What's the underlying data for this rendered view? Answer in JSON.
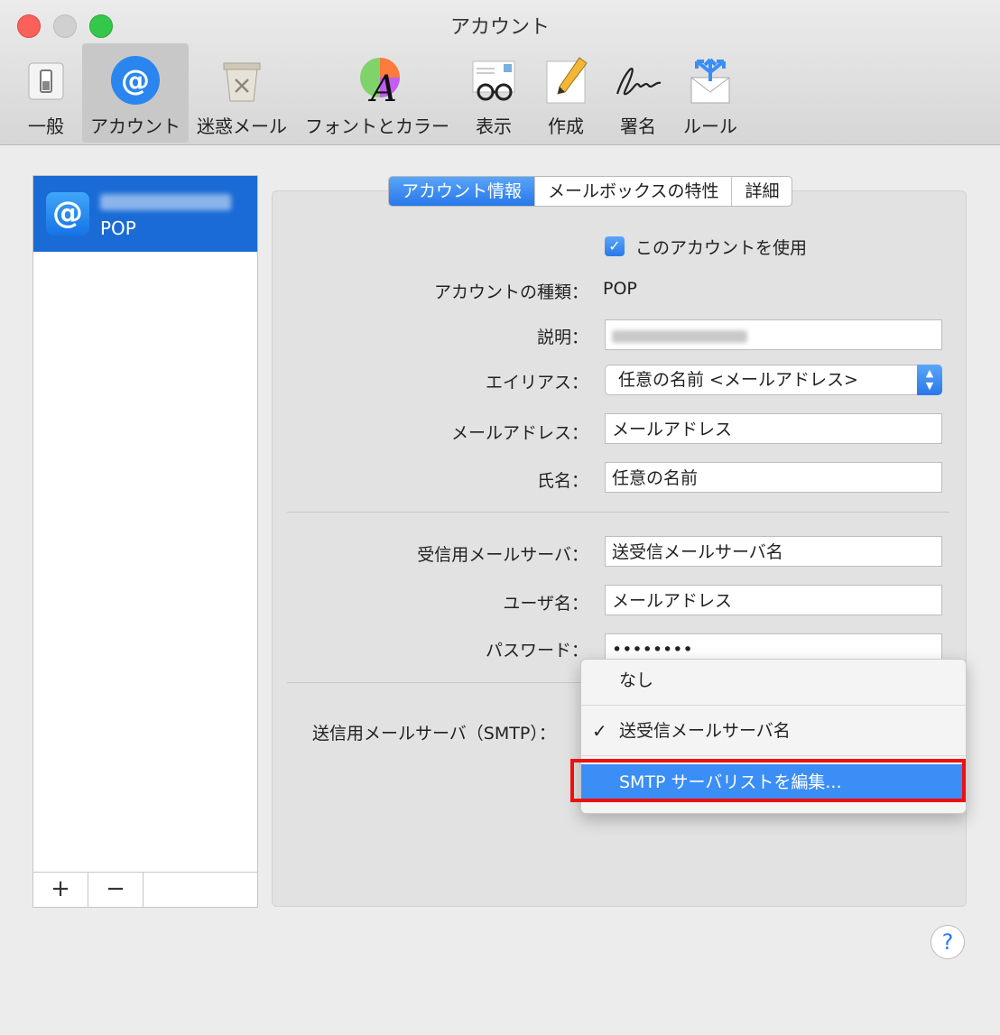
{
  "window": {
    "title": "アカウント"
  },
  "toolbar": {
    "items": [
      {
        "label": "一般",
        "icon": "switch-icon"
      },
      {
        "label": "アカウント",
        "icon": "at-sign-icon",
        "selected": true
      },
      {
        "label": "迷惑メール",
        "icon": "trash-bin-icon"
      },
      {
        "label": "フォントとカラー",
        "icon": "font-color-icon"
      },
      {
        "label": "表示",
        "icon": "glasses-envelope-icon"
      },
      {
        "label": "作成",
        "icon": "pencil-paper-icon"
      },
      {
        "label": "署名",
        "icon": "signature-icon"
      },
      {
        "label": "ルール",
        "icon": "rules-envelope-icon"
      }
    ]
  },
  "account_list": {
    "accounts": [
      {
        "type": "POP",
        "icon": "at-sign-icon"
      }
    ],
    "add_label": "+",
    "remove_label": "−"
  },
  "tabs": [
    {
      "label": "アカウント情報",
      "active": true
    },
    {
      "label": "メールボックスの特性",
      "active": false
    },
    {
      "label": "詳細",
      "active": false
    }
  ],
  "form": {
    "enable_label": "このアカウントを使用",
    "enable_checked": true,
    "type_label": "アカウントの種類：",
    "type_value": "POP",
    "description_label": "説明：",
    "alias_label": "エイリアス：",
    "alias_value": "任意の名前 <メールアドレス>",
    "email_label": "メールアドレス：",
    "email_value": "メールアドレス",
    "name_label": "氏名：",
    "name_value": "任意の名前",
    "incoming_label": "受信用メールサーバ：",
    "incoming_value": "送受信メールサーバ名",
    "username_label": "ユーザ名：",
    "username_value": "メールアドレス",
    "password_label": "パスワード：",
    "password_value": "••••••••",
    "smtp_label": "送信用メールサーバ（SMTP）："
  },
  "smtp_menu": {
    "items": [
      {
        "label": "なし",
        "checked": false
      },
      {
        "label": "送受信メールサーバ名",
        "checked": true
      },
      {
        "label": "SMTP サーバリストを編集...",
        "highlighted": true
      }
    ]
  },
  "help": {
    "label": "?"
  },
  "colors": {
    "accent": "#2a78ea",
    "highlight": "#3a8ef6",
    "annotation": "#ee1010"
  }
}
